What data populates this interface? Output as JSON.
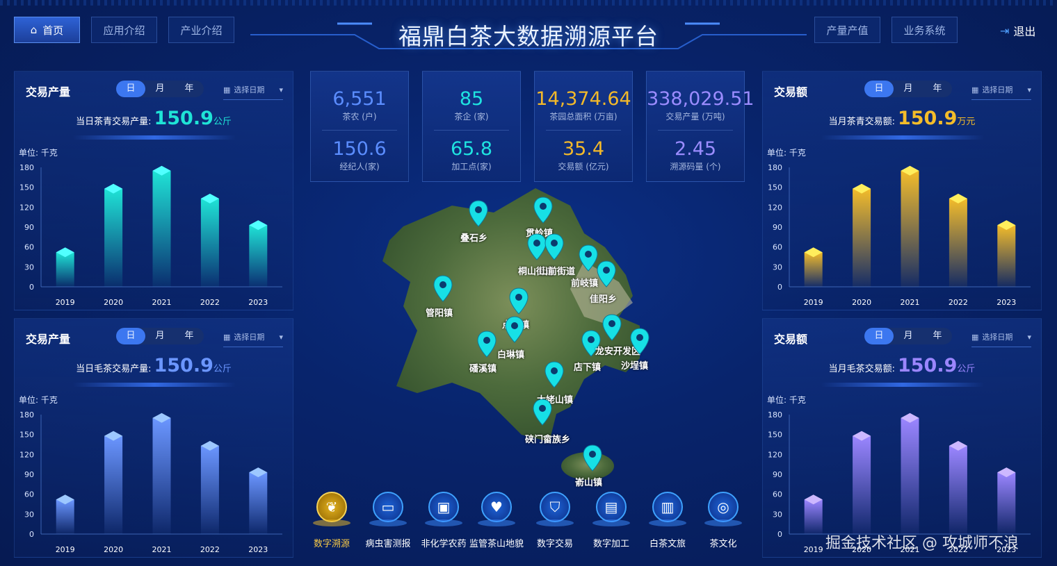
{
  "nav": {
    "home": "首页",
    "app_intro": "应用介绍",
    "industry_intro": "产业介绍",
    "output_value": "产量产值",
    "business": "业务系统",
    "logout": "退出"
  },
  "title": "福鼎白茶大数据溯源平台",
  "stats": [
    {
      "top_value": "6,551",
      "top_label": "茶农 (户)",
      "bottom_value": "150.6",
      "bottom_label": "经纪人(家)",
      "color": "#5b8dff"
    },
    {
      "top_value": "85",
      "top_label": "茶企 (家)",
      "bottom_value": "65.8",
      "bottom_label": "加工点(家)",
      "color": "#1fe3e0"
    },
    {
      "top_value": "14,374.64",
      "top_label": "茶园总面积 (万亩)",
      "bottom_value": "35.4",
      "bottom_label": "交易额 (亿元)",
      "color": "#f3b92a"
    },
    {
      "top_value": "338,029.51",
      "top_label": "交易产量 (万吨)",
      "bottom_value": "2.45",
      "bottom_label": "溯源码量 (个)",
      "color": "#9b8cff"
    }
  ],
  "panels": {
    "tl": {
      "title": "交易产量",
      "seg": [
        "日",
        "月",
        "年"
      ],
      "date": "选择日期",
      "text": "当日茶青交易产量:",
      "value": "150.9",
      "unit": "公斤",
      "y_unit": "单位: 千克",
      "color": "#1fe3d6"
    },
    "bl": {
      "title": "交易产量",
      "seg": [
        "日",
        "月",
        "年"
      ],
      "date": "选择日期",
      "text": "当日毛茶交易产量:",
      "value": "150.9",
      "unit": "公斤",
      "y_unit": "单位: 千克",
      "color": "#6b96ff"
    },
    "tr": {
      "title": "交易额",
      "seg": [
        "日",
        "月",
        "年"
      ],
      "date": "选择日期",
      "text": "当月茶青交易额:",
      "value": "150.9",
      "unit": "万元",
      "y_unit": "单位: 千克",
      "color": "#f3bc2a"
    },
    "br": {
      "title": "交易额",
      "seg": [
        "日",
        "月",
        "年"
      ],
      "date": "选择日期",
      "text": "当月毛茶交易额:",
      "value": "150.9",
      "unit": "公斤",
      "y_unit": "单位: 千克",
      "color": "#9b86ff"
    }
  },
  "chart_data": [
    {
      "type": "bar",
      "categories": [
        "2019",
        "2020",
        "2021",
        "2022",
        "2023"
      ],
      "values": [
        52,
        148,
        175,
        133,
        93
      ],
      "ylim": [
        0,
        180
      ],
      "yticks": [
        0,
        30,
        60,
        90,
        120,
        150,
        180
      ],
      "ylabel": "单位: 千克",
      "color": "#1fe3d6"
    },
    {
      "type": "bar",
      "categories": [
        "2019",
        "2020",
        "2021",
        "2022",
        "2023"
      ],
      "values": [
        52,
        148,
        175,
        133,
        93
      ],
      "ylim": [
        0,
        180
      ],
      "yticks": [
        0,
        30,
        60,
        90,
        120,
        150,
        180
      ],
      "ylabel": "单位: 千克",
      "color": "#6b96ff"
    },
    {
      "type": "bar",
      "categories": [
        "2019",
        "2020",
        "2021",
        "2022",
        "2023"
      ],
      "values": [
        52,
        148,
        175,
        133,
        93
      ],
      "ylim": [
        0,
        180
      ],
      "yticks": [
        0,
        30,
        60,
        90,
        120,
        150,
        180
      ],
      "ylabel": "单位: 千克",
      "color": "#f3bc2a"
    },
    {
      "type": "bar",
      "categories": [
        "2019",
        "2020",
        "2021",
        "2022",
        "2023"
      ],
      "values": [
        52,
        148,
        175,
        133,
        93
      ],
      "ylim": [
        0,
        180
      ],
      "yticks": [
        0,
        30,
        60,
        90,
        120,
        150,
        180
      ],
      "ylabel": "单位: 千克",
      "color": "#9b86ff"
    }
  ],
  "map_labels": [
    "叠石乡",
    "贯岭镇",
    "桐山街道",
    "山前街道",
    "前岐镇",
    "佳阳乡",
    "管阳镇",
    "点头镇",
    "白琳镇",
    "磻溪镇",
    "店下镇",
    "龙安开发区",
    "沙埕镇",
    "太姥山镇",
    "硖门畲族乡",
    "嵛山镇"
  ],
  "menu": [
    {
      "label": "数字溯源",
      "icon": "leaf-icon",
      "active": true
    },
    {
      "label": "病虫害测报",
      "icon": "monitor-icon",
      "active": false
    },
    {
      "label": "非化学农药",
      "icon": "box-icon",
      "active": false
    },
    {
      "label": "监管茶山地貌",
      "icon": "heart-hand-icon",
      "active": false
    },
    {
      "label": "数字交易",
      "icon": "shield-icon",
      "active": false
    },
    {
      "label": "数字加工",
      "icon": "factory-icon",
      "active": false
    },
    {
      "label": "白茶文旅",
      "icon": "book-icon",
      "active": false
    },
    {
      "label": "茶文化",
      "icon": "coins-icon",
      "active": false
    }
  ],
  "watermark": "掘金技术社区 @ 攻城师不浪"
}
